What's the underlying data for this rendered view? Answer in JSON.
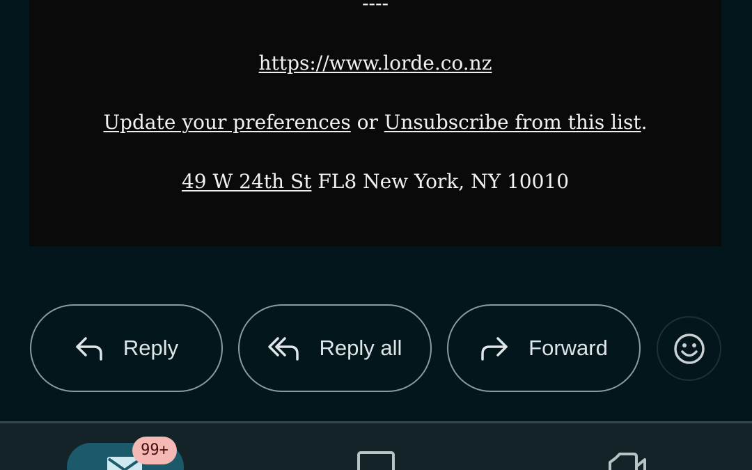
{
  "email": {
    "separator": "----",
    "website_link": "https://www.lorde.co.nz",
    "update_prefs_link": "Update your preferences",
    "or_text": " or ",
    "unsubscribe_link": "Unsubscribe from this list",
    "period": ".",
    "address_link": "49 W 24th St",
    "address_rest": " FL8 New York, NY 10010"
  },
  "actions": {
    "reply_label": "Reply",
    "reply_all_label": "Reply all",
    "forward_label": "Forward"
  },
  "icons": {
    "reply": "reply-arrow-icon",
    "reply_all": "reply-all-arrow-icon",
    "forward": "forward-arrow-icon",
    "emoji": "smiley-face-icon",
    "mail": "mail-envelope-icon",
    "chat": "chat-bubble-icon",
    "meet": "video-camera-icon"
  },
  "bottom_nav": {
    "mail_badge": "99+"
  },
  "colors": {
    "background": "#03161b",
    "card": "#0a0a0a",
    "active_pill": "#1c5a6b",
    "badge": "#f6b8b5"
  }
}
